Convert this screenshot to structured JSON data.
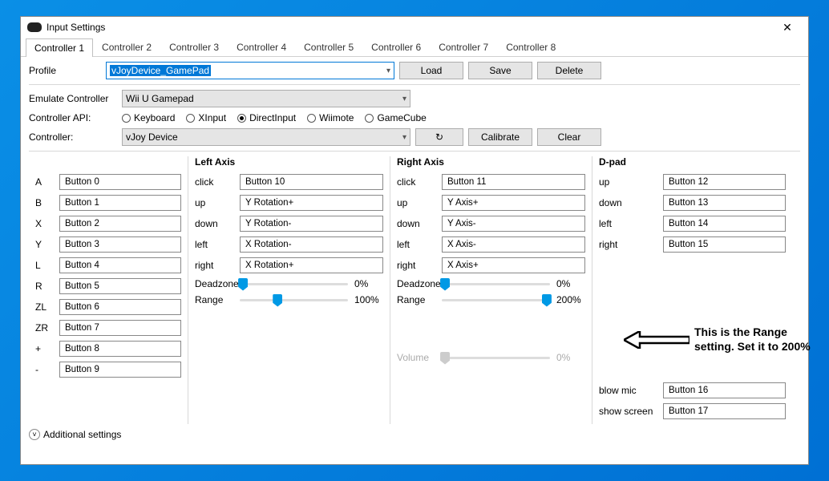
{
  "window": {
    "title": "Input Settings"
  },
  "tabs": [
    "Controller 1",
    "Controller 2",
    "Controller 3",
    "Controller 4",
    "Controller 5",
    "Controller 6",
    "Controller 7",
    "Controller 8"
  ],
  "activeTab": 0,
  "profile": {
    "label": "Profile",
    "value": "vJoyDevice_GamePad"
  },
  "buttons": {
    "load": "Load",
    "save": "Save",
    "delete": "Delete",
    "calibrate": "Calibrate",
    "clear": "Clear"
  },
  "emulate": {
    "label": "Emulate Controller",
    "value": "Wii U Gamepad"
  },
  "api": {
    "label": "Controller API:",
    "options": [
      "Keyboard",
      "XInput",
      "DirectInput",
      "Wiimote",
      "GameCube"
    ],
    "selected": "DirectInput"
  },
  "controller": {
    "label": "Controller:",
    "value": "vJoy Device"
  },
  "sections": {
    "buttons": {
      "header": ""
    },
    "leftAxis": {
      "header": "Left Axis"
    },
    "rightAxis": {
      "header": "Right Axis"
    },
    "dpad": {
      "header": "D-pad"
    }
  },
  "mainButtons": [
    {
      "label": "A",
      "value": "Button 0"
    },
    {
      "label": "B",
      "value": "Button 1"
    },
    {
      "label": "X",
      "value": "Button 2"
    },
    {
      "label": "Y",
      "value": "Button 3"
    },
    {
      "label": "L",
      "value": "Button 4"
    },
    {
      "label": "R",
      "value": "Button 5"
    },
    {
      "label": "ZL",
      "value": "Button 6"
    },
    {
      "label": "ZR",
      "value": "Button 7"
    },
    {
      "label": "+",
      "value": "Button 8"
    },
    {
      "label": "-",
      "value": "Button 9"
    }
  ],
  "leftAxis": {
    "click": {
      "label": "click",
      "value": "Button 10"
    },
    "up": {
      "label": "up",
      "value": "Y Rotation+"
    },
    "down": {
      "label": "down",
      "value": "Y Rotation-"
    },
    "left": {
      "label": "left",
      "value": "X Rotation-"
    },
    "right": {
      "label": "right",
      "value": "X Rotation+"
    },
    "deadzone": {
      "label": "Deadzone",
      "value": "0%",
      "pos": 3
    },
    "range": {
      "label": "Range",
      "value": "100%",
      "pos": 35
    }
  },
  "rightAxis": {
    "click": {
      "label": "click",
      "value": "Button 11"
    },
    "up": {
      "label": "up",
      "value": "Y Axis+"
    },
    "down": {
      "label": "down",
      "value": "Y Axis-"
    },
    "left": {
      "label": "left",
      "value": "X Axis-"
    },
    "right": {
      "label": "right",
      "value": "X Axis+"
    },
    "deadzone": {
      "label": "Deadzone",
      "value": "0%",
      "pos": 3
    },
    "range": {
      "label": "Range",
      "value": "200%",
      "pos": 97
    },
    "volume": {
      "label": "Volume",
      "value": "0%",
      "pos": 3
    }
  },
  "dpad": {
    "up": {
      "label": "up",
      "value": "Button 12"
    },
    "down": {
      "label": "down",
      "value": "Button 13"
    },
    "left": {
      "label": "left",
      "value": "Button 14"
    },
    "right": {
      "label": "right",
      "value": "Button 15"
    }
  },
  "extra": {
    "blowMic": {
      "label": "blow mic",
      "value": "Button 16"
    },
    "showScreen": {
      "label": "show screen",
      "value": "Button 17"
    }
  },
  "additional": "Additional settings",
  "annotation": "This is the Range setting. Set it to 200%"
}
